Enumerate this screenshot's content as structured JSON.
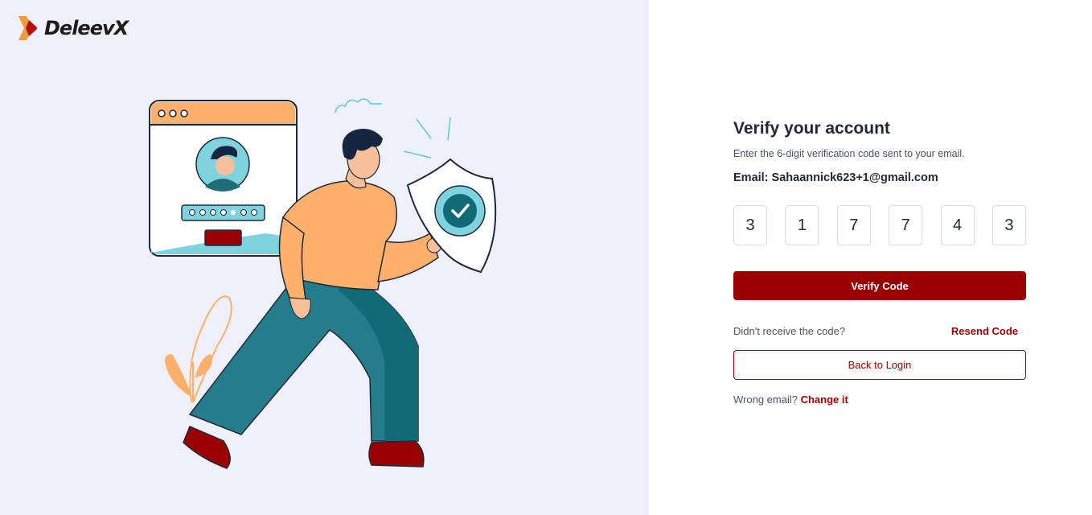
{
  "brand": {
    "name": "DeleevX",
    "logo_icon": "deleevx-logo-icon"
  },
  "illustration": {
    "icon": "security-shield-illustration",
    "password_mask": [
      "●",
      "●",
      "●",
      "●",
      "●",
      "●"
    ]
  },
  "form": {
    "title": "Verify your account",
    "subtitle": "Enter the 6-digit verification code sent to your email.",
    "email_label": "Email: ",
    "email_value": "Sahaannick623+1@gmail.com",
    "code_digits": [
      "3",
      "1",
      "7",
      "7",
      "4",
      "3"
    ],
    "verify_button": "Verify Code",
    "resend_prompt": "Didn't receive the code?",
    "resend_link": "Resend Code",
    "back_button": "Back to Login",
    "wrong_email_prompt": "Wrong email? ",
    "change_link": "Change it"
  },
  "colors": {
    "primary": "#990000",
    "left_bg": "#eff0fb",
    "text_dark": "#1f2937"
  }
}
